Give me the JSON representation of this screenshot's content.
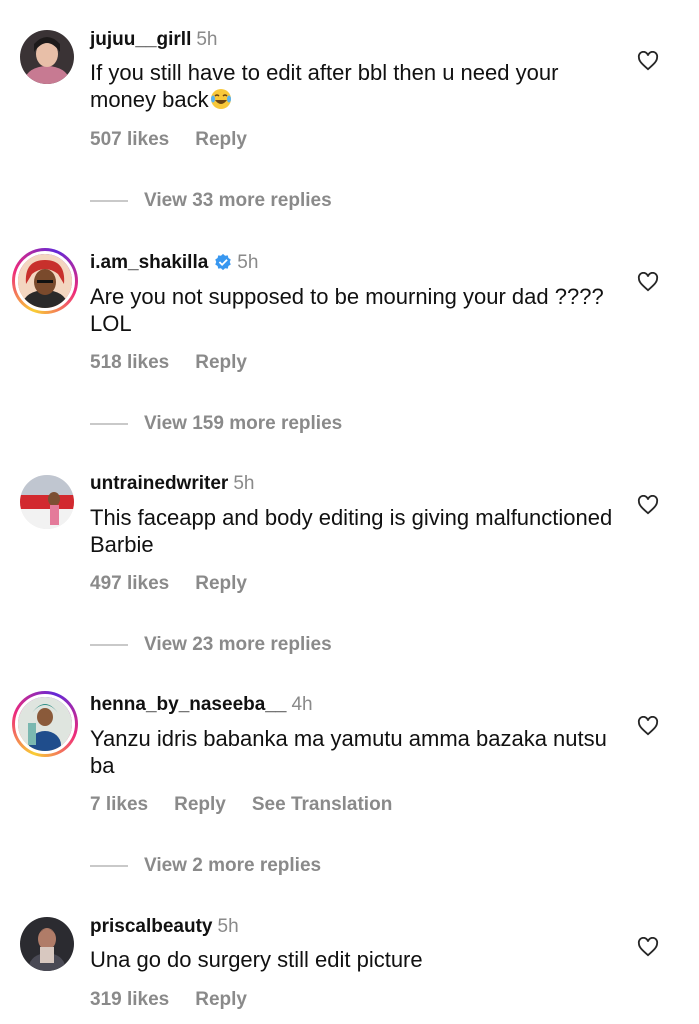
{
  "comments": [
    {
      "username": "jujuu__girll",
      "time": "5h",
      "text": "If you still have to edit after bbl then u need your money back",
      "emoji": "face-with-tears-of-joy",
      "likes": "507 likes",
      "reply": "Reply",
      "view_replies": "View 33 more replies"
    },
    {
      "username": "i.am_shakilla",
      "time": "5h",
      "verified": true,
      "text": "Are you not supposed to be mourning your dad ???? LOL",
      "likes": "518 likes",
      "reply": "Reply",
      "view_replies": "View 159 more replies"
    },
    {
      "username": "untrainedwriter",
      "time": "5h",
      "text": "This faceapp and body editing is giving malfunctioned Barbie",
      "likes": "497 likes",
      "reply": "Reply",
      "view_replies": "View 23 more replies"
    },
    {
      "username": "henna_by_naseeba__",
      "time": "4h",
      "text": "Yanzu idris babanka ma yamutu amma bazaka nutsu ba",
      "likes": "7 likes",
      "reply": "Reply",
      "see_translation": "See Translation",
      "view_replies": "View 2 more replies"
    },
    {
      "username": "priscalbeauty",
      "time": "5h",
      "text": "Una go do surgery still edit picture",
      "likes": "319 likes",
      "reply": "Reply"
    }
  ],
  "colors": {
    "text": "#111111",
    "muted": "#8a8a8a",
    "verified": "#3897f0",
    "divider": "#c9c9c9"
  }
}
